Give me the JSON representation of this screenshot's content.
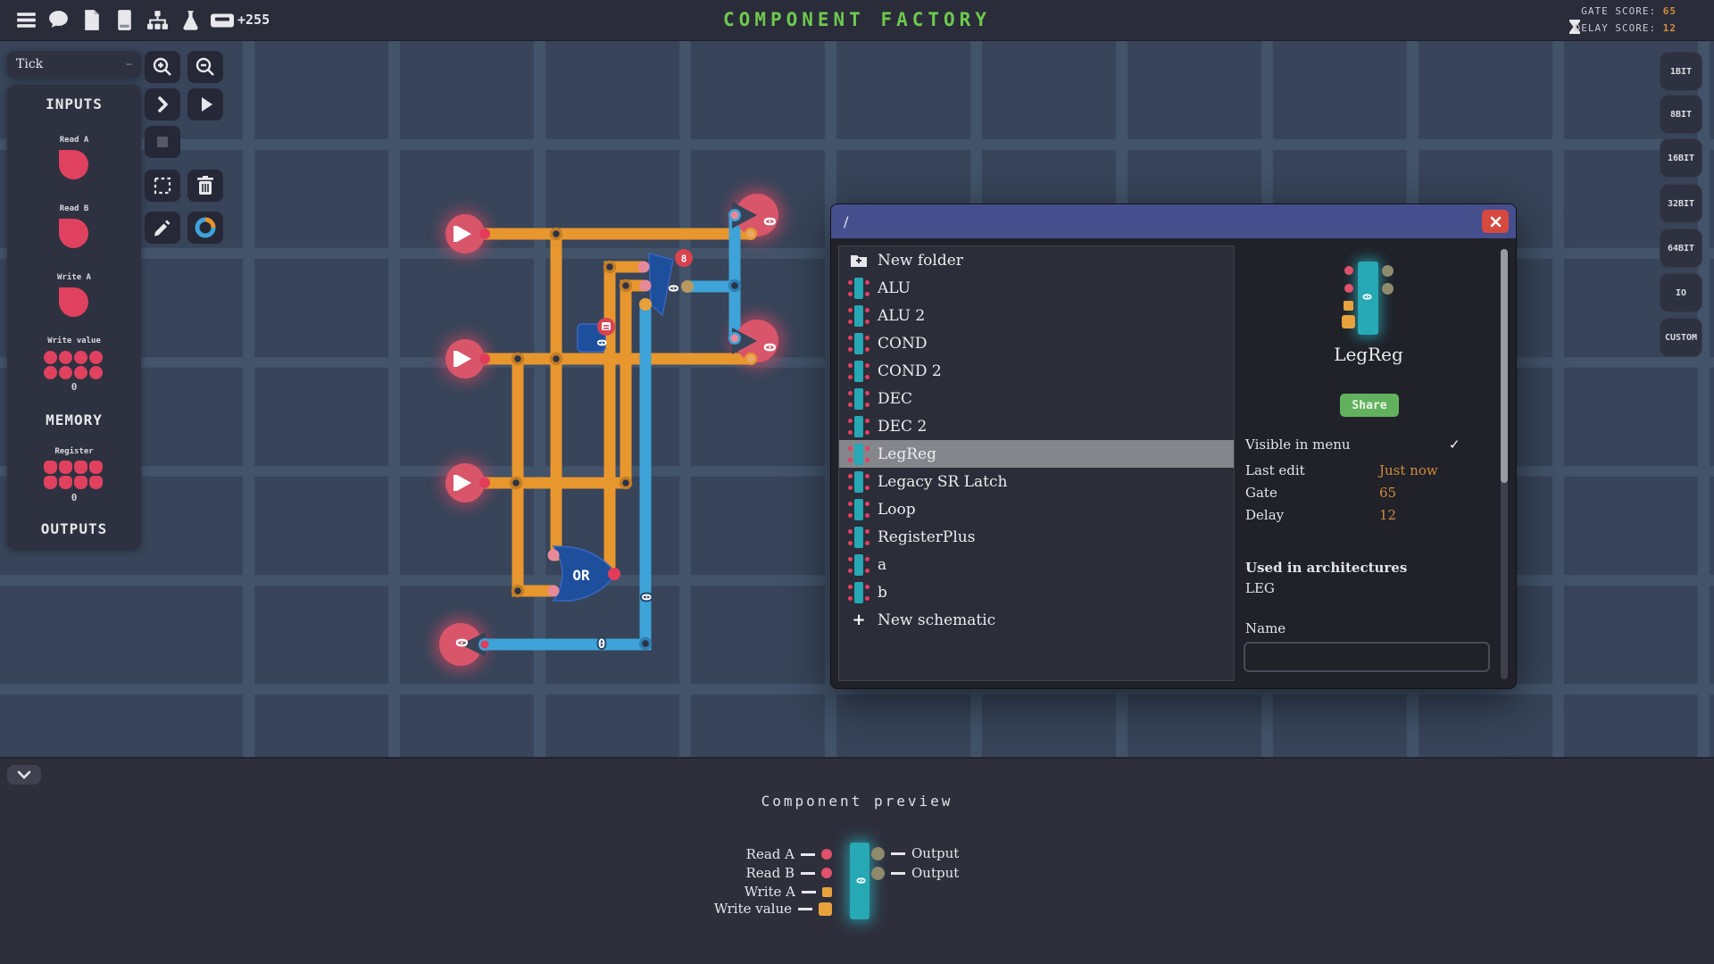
{
  "top_bar": {
    "title": "COMPONENT FACTORY",
    "coins": "+255",
    "gate_score_label": "GATE SCORE:",
    "gate_score_value": "65",
    "delay_score_label": "DELAY SCORE:",
    "delay_score_value": "12"
  },
  "left_panel": {
    "tick_label": "Tick",
    "tick_minus": "–",
    "inputs_header": "INPUTS",
    "input_items": [
      {
        "label": "Read A"
      },
      {
        "label": "Read B"
      },
      {
        "label": "Write A"
      }
    ],
    "write_value_label": "Write value",
    "write_value_value": "0",
    "memory_header": "MEMORY",
    "register_label": "Register",
    "register_value": "0",
    "outputs_header": "OUTPUTS"
  },
  "dialog": {
    "path": "/",
    "items": [
      {
        "label": "New folder"
      },
      {
        "label": "ALU"
      },
      {
        "label": "ALU 2"
      },
      {
        "label": "COND"
      },
      {
        "label": "COND 2"
      },
      {
        "label": "DEC"
      },
      {
        "label": "DEC 2"
      },
      {
        "label": "LegReg"
      },
      {
        "label": "Legacy SR Latch"
      },
      {
        "label": "Loop"
      },
      {
        "label": "RegisterPlus"
      },
      {
        "label": "a"
      },
      {
        "label": "b"
      },
      {
        "label": "New schematic"
      }
    ],
    "selected_item": "LegReg",
    "detail": {
      "component_name": "LegReg",
      "component_value": "0",
      "share_label": "Share",
      "visible_in_menu_label": "Visible in menu",
      "visible_checkmark": "✓",
      "last_edit_label": "Last edit",
      "last_edit_value": "Just now",
      "gate_label": "Gate",
      "gate_value": "65",
      "delay_label": "Delay",
      "delay_value": "12",
      "used_in_label": "Used in architectures",
      "used_in_value": "LEG",
      "name_label": "Name",
      "name_value": ""
    }
  },
  "bit_buttons": [
    "1BIT",
    "8BIT",
    "16BIT",
    "32BIT",
    "64BIT",
    "IO",
    "CUSTOM"
  ],
  "canvas": {
    "output_values": [
      "0",
      "0",
      "0"
    ],
    "or_gate_label": "OR",
    "switch_gate_value": "0",
    "switch_gate_badge": "8",
    "register_cell_value": "0",
    "wire_labels": [
      "0",
      "0"
    ]
  },
  "bottom_panel": {
    "title": "Component preview",
    "component_value": "0",
    "left_ports": [
      "Read A",
      "Read B",
      "Write A",
      "Write value"
    ],
    "right_ports": [
      "Output",
      "Output"
    ]
  },
  "colors": {
    "wire_orange": "#e8962e",
    "wire_blue": "#3ea3d8",
    "node_red": "#d9566a",
    "component_teal": "#26a8b5",
    "title_green": "#6ec94d",
    "value_orange": "#cf8d3a",
    "share_green": "#62b15e",
    "close_red": "#d6493f"
  }
}
